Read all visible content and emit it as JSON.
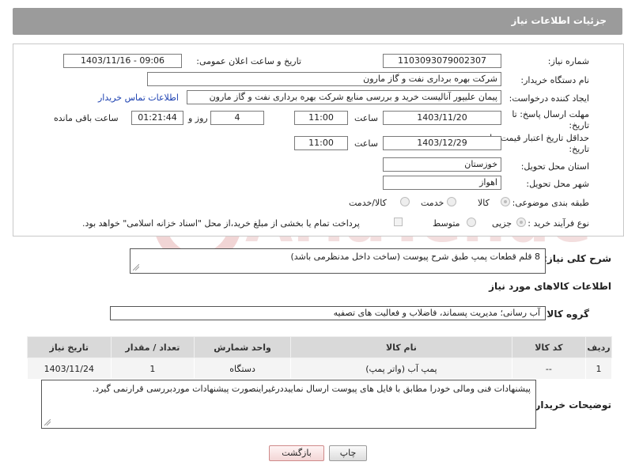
{
  "header": {
    "title": "جزئیات اطلاعات نیاز"
  },
  "form": {
    "need_number": {
      "label": "شماره نیاز:",
      "value": "1103093079002307"
    },
    "announce": {
      "label": "تاریخ و ساعت اعلان عمومی:",
      "value": "1403/11/16 - 09:06"
    },
    "buyer_org": {
      "label": "نام دستگاه خریدار:",
      "value": "شرکت بهره برداری نفت و گاز مارون"
    },
    "requester": {
      "label": "ایجاد کننده درخواست:",
      "value": "پیمان علیپور آنالیست خرید و بررسی منابع شرکت بهره برداری نفت و گاز مارون",
      "contact_link": "اطلاعات تماس خریدار"
    },
    "deadline": {
      "label": "مهلت ارسال پاسخ: تا تاریخ:",
      "date": "1403/11/20",
      "time_label": "ساعت",
      "time": "11:00",
      "days": "4",
      "days_label": "روز و",
      "remaining": "01:21:44",
      "remaining_label": "ساعت باقی مانده"
    },
    "validity": {
      "label": "حداقل تاریخ اعتبار قیمت: تا تاریخ:",
      "date": "1403/12/29",
      "time_label": "ساعت",
      "time": "11:00"
    },
    "province": {
      "label": "استان محل تحویل:",
      "value": "خوزستان"
    },
    "city": {
      "label": "شهر محل تحویل:",
      "value": "اهواز"
    },
    "category": {
      "label": "طبقه بندی موضوعی:",
      "options": [
        "کالا",
        "خدمت",
        "کالا/خدمت"
      ],
      "selected": "کالا"
    },
    "process": {
      "label": "نوع فرآیند خرید :",
      "options": [
        "جزیی",
        "متوسط"
      ],
      "selected": "جزیی",
      "payment_note": "پرداخت تمام یا بخشی از مبلغ خرید،از محل \"اسناد خزانه اسلامی\" خواهد بود."
    }
  },
  "summary": {
    "label": "شرح کلی نیاز:",
    "value": "8 قلم قطعات پمپ طبق شرح پیوست (ساخت داخل مدنظرمی باشد)"
  },
  "goods_section": {
    "title": "اطلاعات کالاهای مورد نیاز"
  },
  "goods_group": {
    "label": "گروه کالا:",
    "value": "آب رسانی؛ مدیریت پسماند، فاضلاب و فعالیت های تصفیه"
  },
  "table": {
    "headers": [
      "ردیف",
      "کد کالا",
      "نام کالا",
      "واحد شمارش",
      "تعداد / مقدار",
      "تاریخ نیاز"
    ],
    "rows": [
      [
        "1",
        "--",
        "پمپ آب (واتر پمپ)",
        "دستگاه",
        "1",
        "1403/11/24"
      ]
    ]
  },
  "buyer_notes": {
    "label": "توضیحات خریدار:",
    "value": "پیشنهادات فنی ومالی خودرا  مطابق با فایل های پیوست ارسال نماییددرغیراینصورت پیشنهادات موردبررسی قرارنمی گیرد."
  },
  "buttons": {
    "print": "چاپ",
    "back": "بازگشت"
  },
  "watermark": {
    "text": "AriaTender.net",
    "color": "#f1d5d5"
  }
}
